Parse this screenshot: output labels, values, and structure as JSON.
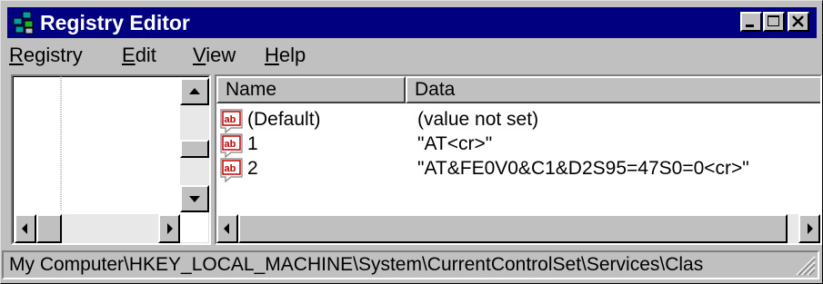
{
  "window": {
    "title": "Registry Editor"
  },
  "menu": [
    {
      "ul": "R",
      "rest": "egistry"
    },
    {
      "ul": "E",
      "rest": "dit"
    },
    {
      "ul": "V",
      "rest": "iew"
    },
    {
      "ul": "H",
      "rest": "elp"
    }
  ],
  "list": {
    "columns": {
      "name": "Name",
      "data": "Data"
    },
    "rows": [
      {
        "name": "(Default)",
        "data": "(value not set)"
      },
      {
        "name": "1",
        "data": "\"AT<cr>\""
      },
      {
        "name": "2",
        "data": "\"AT&FE0V0&C1&D2S95=47S0=0<cr>\""
      }
    ],
    "icon": "string-value-icon"
  },
  "status": {
    "path": "My Computer\\HKEY_LOCAL_MACHINE\\System\\CurrentControlSet\\Services\\Clas"
  },
  "colors": {
    "title_bar": "#000080",
    "face": "#c0c0c0",
    "window": "#ffffff"
  }
}
